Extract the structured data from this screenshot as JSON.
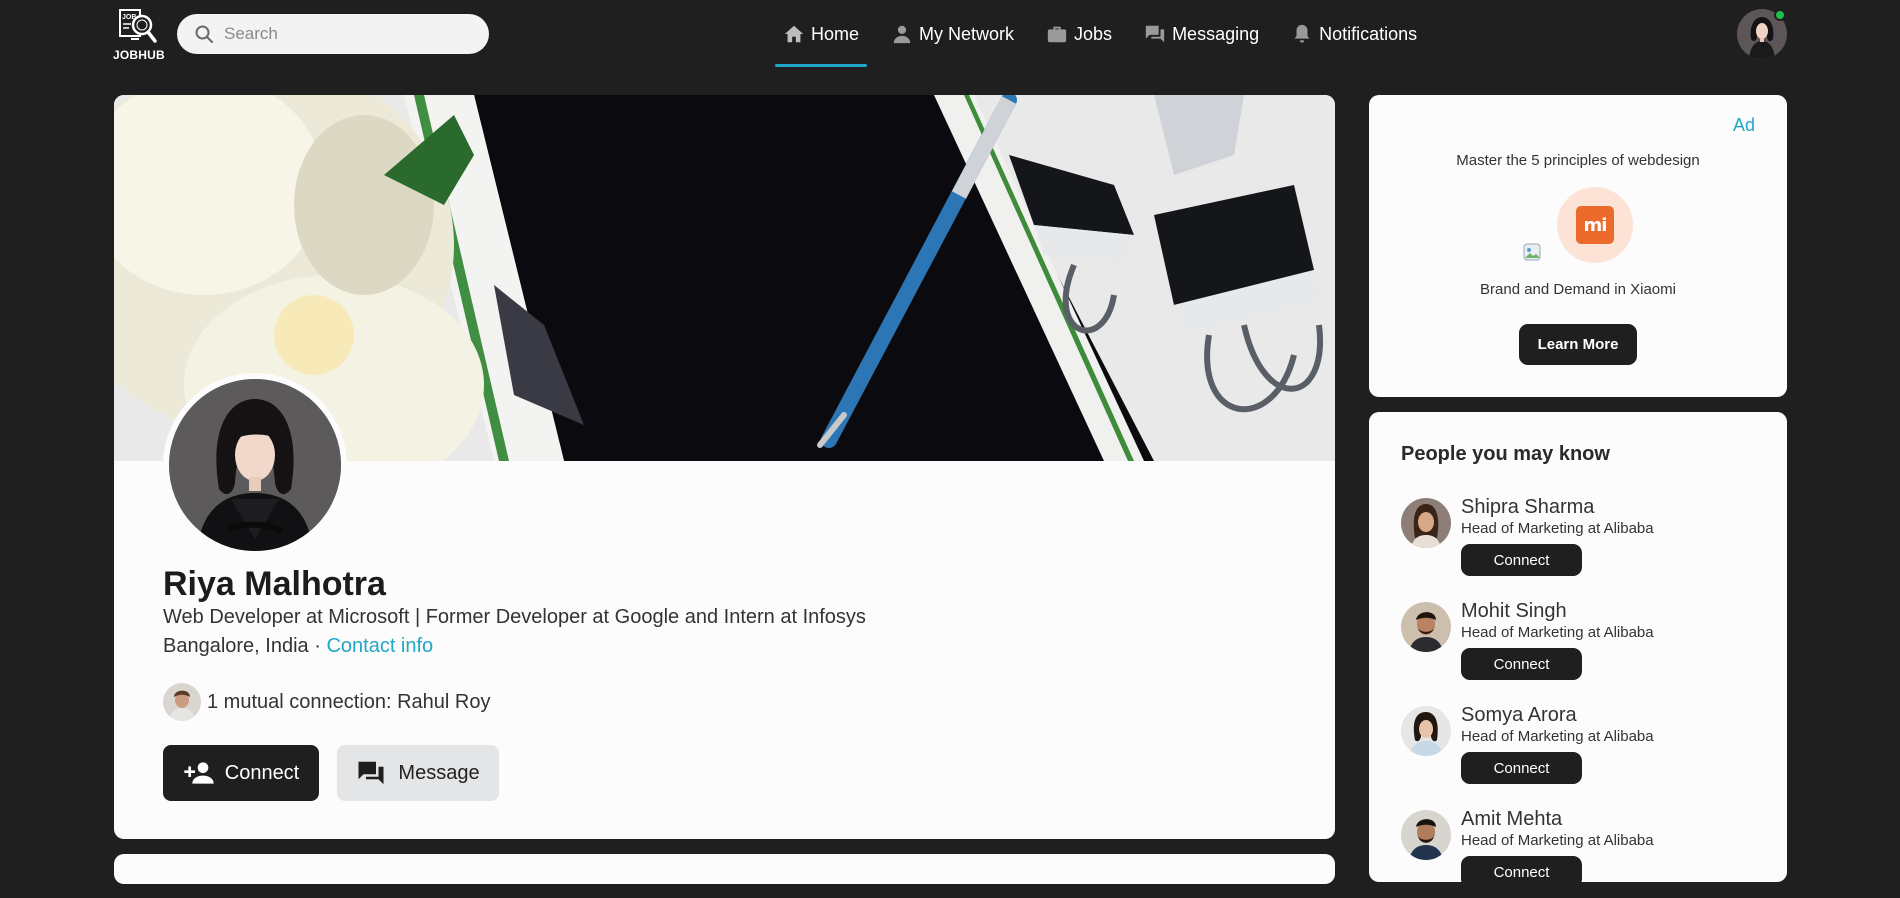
{
  "brand": {
    "logo_text": "JOBHUB",
    "icon": "magnifier-document-icon"
  },
  "search": {
    "placeholder": "Search",
    "value": ""
  },
  "nav": {
    "items": [
      {
        "label": "Home",
        "icon": "home-icon",
        "active": true
      },
      {
        "label": "My Network",
        "icon": "person-icon",
        "active": false
      },
      {
        "label": "Jobs",
        "icon": "briefcase-icon",
        "active": false
      },
      {
        "label": "Messaging",
        "icon": "chat-icon",
        "active": false
      },
      {
        "label": "Notifications",
        "icon": "bell-icon",
        "active": false
      }
    ],
    "accent_color": "#1fa7c9"
  },
  "user_menu": {
    "status": "online",
    "status_color": "#1ec24a"
  },
  "profile": {
    "name": "Riya Malhotra",
    "headline": "Web Developer at Microsoft | Former Developer at Google and Intern at Infosys",
    "location": "Bangalore, India",
    "separator": " · ",
    "contact_info_label": "Contact info",
    "mutual_connection_text": "1 mutual connection: Rahul Roy",
    "connect_label": "Connect",
    "message_label": "Message"
  },
  "ad": {
    "label": "Ad",
    "title": "Master the 5 principles of webdesign",
    "brand_logo_text": "mi",
    "brand_text": "Brand and Demand in Xiaomi",
    "cta_label": "Learn More"
  },
  "people": {
    "title": "People you may know",
    "connect_label": "Connect",
    "items": [
      {
        "name": "Shipra Sharma",
        "role": "Head of Marketing at Alibaba"
      },
      {
        "name": "Mohit Singh",
        "role": "Head of Marketing at Alibaba"
      },
      {
        "name": "Somya Arora",
        "role": "Head of Marketing at Alibaba"
      },
      {
        "name": "Amit Mehta",
        "role": "Head of Marketing at Alibaba"
      }
    ]
  },
  "colors": {
    "dark": "#1f1f1f",
    "card": "#fcfcfc",
    "link": "#1fa7c9"
  }
}
